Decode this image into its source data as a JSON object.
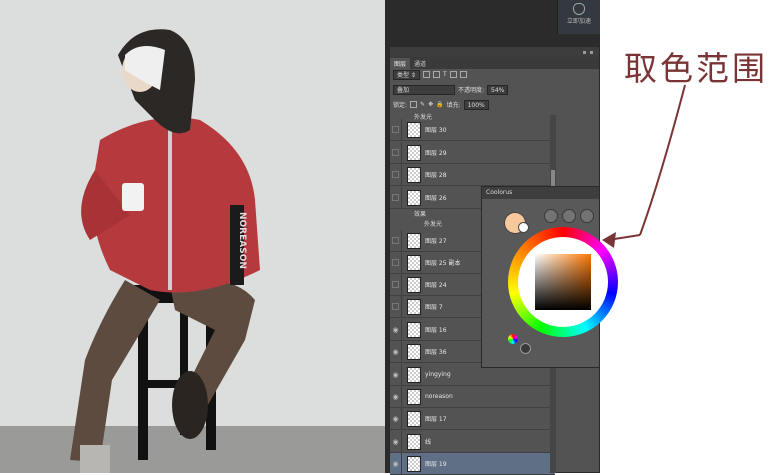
{
  "ps_top_button": {
    "label": "立即加速"
  },
  "layers_panel": {
    "tabs": [
      "图层",
      "通道"
    ],
    "filter_label": "类型",
    "blend_mode": "叠加",
    "opacity_label": "不透明度:",
    "opacity_value": "54%",
    "lock_label": "锁定:",
    "fill_label": "填充:",
    "fill_value": "100%",
    "top_fx_label": "外发光",
    "layers": [
      {
        "name": "图层 30",
        "visible": false
      },
      {
        "name": "图层 29",
        "visible": false
      },
      {
        "name": "图层 28",
        "visible": false
      },
      {
        "name": "图层 26",
        "visible": false
      },
      {
        "name": "图层 27",
        "visible": false
      },
      {
        "name": "图层 25 副本",
        "visible": false
      },
      {
        "name": "图层 24",
        "visible": false
      },
      {
        "name": "图层 7",
        "visible": false
      },
      {
        "name": "图层 16",
        "visible": true
      },
      {
        "name": "图层 36",
        "visible": true
      },
      {
        "name": "yingying",
        "visible": true
      },
      {
        "name": "noreason",
        "visible": true
      },
      {
        "name": "图层 17",
        "visible": true
      },
      {
        "name": "线",
        "visible": true
      },
      {
        "name": "图层 19",
        "visible": true,
        "selected": true
      }
    ],
    "effects_label": "效果",
    "effect_item": "外发光"
  },
  "coolorus": {
    "title": "Coolorus",
    "foreground_color": "#f8c89a",
    "background_color": "#ffffff"
  },
  "illustration": {
    "sleeve_text": "NOREASON"
  },
  "annotation": {
    "text": "取色范围",
    "color": "#7a3436"
  }
}
